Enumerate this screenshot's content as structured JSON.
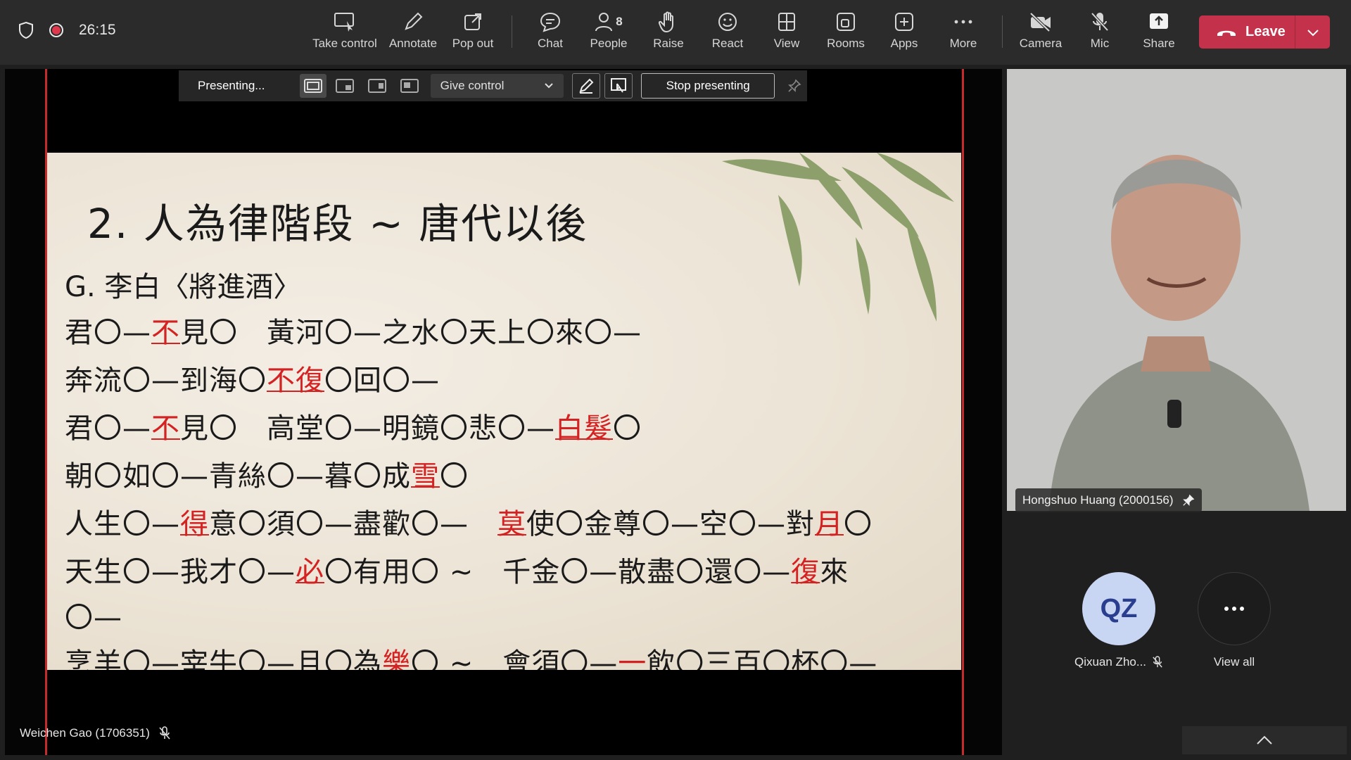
{
  "meeting": {
    "timer": "26:15"
  },
  "toolbar": {
    "take_control": "Take control",
    "annotate": "Annotate",
    "pop_out": "Pop out",
    "chat": "Chat",
    "people": "People",
    "people_count": "8",
    "raise": "Raise",
    "react": "React",
    "view": "View",
    "rooms": "Rooms",
    "apps": "Apps",
    "more": "More",
    "camera": "Camera",
    "mic": "Mic",
    "share": "Share",
    "leave": "Leave"
  },
  "presenter_bar": {
    "status": "Presenting...",
    "give_control": "Give control",
    "stop_presenting": "Stop presenting"
  },
  "slide": {
    "title": "2.  人為律階段 ~ 唐代以後",
    "subtitle": "G. 李白〈將進酒〉",
    "lines": [
      {
        "pre": "君〇—",
        "hl1": "不",
        "mid": "見〇　黃河〇—之水〇天上〇來〇—",
        "hl2": "",
        "post": ""
      },
      {
        "pre": "奔流〇—到海〇",
        "hl1": "不復",
        "mid": "〇回〇—",
        "hl2": "",
        "post": ""
      },
      {
        "pre": "君〇—",
        "hl1": "不",
        "mid": "見〇　高堂〇—明鏡〇悲〇—",
        "hl2": "白髮",
        "post": "〇"
      },
      {
        "pre": "朝〇如〇—青絲〇—暮〇成",
        "hl1": "雪",
        "mid": "〇",
        "hl2": "",
        "post": ""
      },
      {
        "pre": "人生〇—",
        "hl1": "得",
        "mid": "意〇須〇—盡歡〇—　",
        "hl2": "莫",
        "post": "使〇金尊〇—空〇—對"
      },
      {
        "pre": "天生〇—我才〇—",
        "hl1": "必",
        "mid": "〇有用〇 ~　千金〇—散盡〇還〇—",
        "hl2": "復",
        "post": "來"
      },
      {
        "pre": "〇—",
        "hl1": "",
        "mid": "",
        "hl2": "",
        "post": ""
      },
      {
        "pre": "烹羊〇—宰牛〇—且〇為",
        "hl1": "樂",
        "mid": "〇 ~　會須〇—",
        "hl2": "一",
        "post": "飲〇三百〇杯〇—"
      }
    ],
    "line5_tail_hl": "月",
    "line5_tail": "〇"
  },
  "self_view": {
    "name": "Weichen Gao (1706351)"
  },
  "spotlight": {
    "name": "Hongshuo Huang (2000156)"
  },
  "participants": [
    {
      "initials": "QZ",
      "name": "Qixuan Zho..."
    }
  ],
  "view_all": "View all",
  "colors": {
    "leave": "#c4314b",
    "share_border": "#c72a2a",
    "slide_highlight": "#d42121",
    "avatar_bg": "#c9d6f3"
  }
}
